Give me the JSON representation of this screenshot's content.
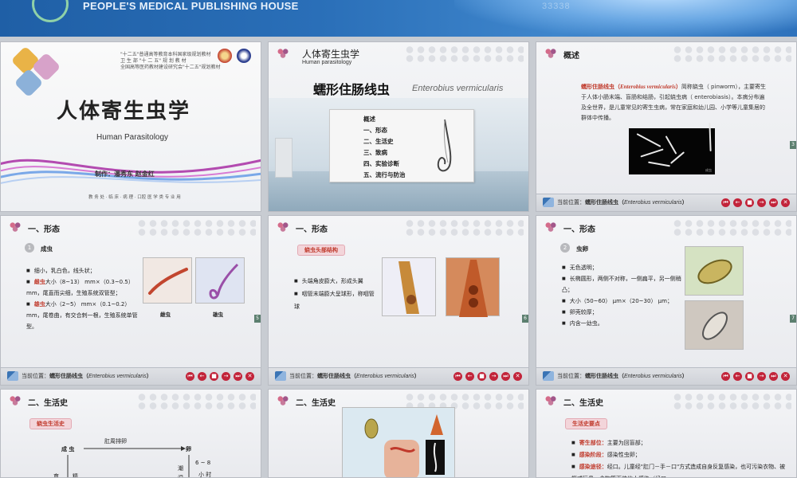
{
  "header": {
    "publisher": "PEOPLE'S MEDICAL PUBLISHING HOUSE",
    "ghost_number": "33338"
  },
  "colors": {
    "banner_blue": "#2a6fb8",
    "accent_red": "#c0392b",
    "nav_red": "#c2243a"
  },
  "slides": {
    "s1": {
      "top_lines": [
        "\"十二五\"普通高等教育本科国家级规划教材",
        "卫 生 部 \"十 二 五\" 规 划 教 材",
        "全国高等医药教材建设研究会\"十二五\"规划教材"
      ],
      "title": "人体寄生虫学",
      "subtitle": "Human Parasitology",
      "author": "制作：潘秀东  赵金红",
      "foot": "教 务 处 · 临 床 · 病 理 · 口腔 医 学 类 专 业 用"
    },
    "s2": {
      "head_cn": "人体寄生虫学",
      "head_en": "Human parasitology",
      "main_cn": "蠕形住肠线虫",
      "main_en": "Enterobius vermicularis",
      "toc": [
        "概述",
        "一、形态",
        "二、生活史",
        "三、致病",
        "四、实验诊断",
        "五、流行与防治"
      ]
    },
    "s3": {
      "title": "概述",
      "para_red": "蠕形住肠线虫（",
      "para_redi": "Enterobius vermicularis",
      "para_red2": "）",
      "para_rest": "简称蛲虫（ pinworm），主要寄生于人体小肠末端、盲肠和结肠，引起蛲虫病（ enterobiasis）。本病分布遍及全世界，是儿童常见的寄生虫病，常在家庭和幼儿园、小学等儿童集居的群体中传播。",
      "img_caption": "成虫",
      "page": "3"
    },
    "footer": {
      "loc_prefix": "当前位置：",
      "loc_main": "蠕形住肠线虫（",
      "loc_en": "Enterobius vermicularis",
      "loc_end": "）",
      "nav": [
        "⏮",
        "←",
        "■",
        "→",
        "⏭",
        "✕"
      ]
    },
    "s4": {
      "title": "一、形态",
      "num": "1",
      "sub": "成虫",
      "b1": "细小，乳白色，线头状；",
      "b2_red": "雌虫",
      "b2": "大小（8~13） mm×（0.3~0.5） mm，尾直而尖细，生殖系统双管型；",
      "b3_red": "雄虫",
      "b3": "大小（2~5） mm×（0.1~0.2） mm，尾卷曲，有交合刺一根，生殖系统单管型。",
      "cap_female": "雌虫",
      "cap_male": "雄虫",
      "page": "5"
    },
    "s5": {
      "title": "一、形态",
      "tag": "蛲虫头部结构",
      "b1": "头端角皮膨大，形成头翼",
      "b2": "咽管末端膨大呈球形，称咽管球",
      "page": "6"
    },
    "s6": {
      "title": "一、形态",
      "num": "2",
      "sub": "虫卵",
      "b": [
        "无色透明；",
        "长椭圆形，两侧不对称，一侧扁平，另一侧稍凸；",
        "大小（50~60） μm×（20~30） μm；",
        "卵壳较厚；",
        "内含一幼虫。"
      ],
      "page": "7"
    },
    "s7": {
      "title": "二、生活史",
      "tag": "蛲虫生活史",
      "n_adult": "成 虫",
      "n_egg": "卵",
      "edge_top": "肛周排卵",
      "edge_right": "6 ~ 8",
      "edge_right2": "小 时",
      "v1": "育",
      "v2": "精",
      "v3": "潮",
      "v4": "湿"
    },
    "s8": {
      "title": "二、生活史"
    },
    "s9": {
      "title": "二、生活史",
      "tag": "生活史要点",
      "b1_red": "寄生部位：",
      "b1": "主要为回盲部；",
      "b2_red": "感染阶段：",
      "b2": "感染性虫卵；",
      "b3_red": "感染途径：",
      "b3": "经口。儿童经\"肛门－手－口\"方式造成自身反复感染，也可污染衣物、被褥或玩具，食物等而使他人感染（经口"
    }
  }
}
